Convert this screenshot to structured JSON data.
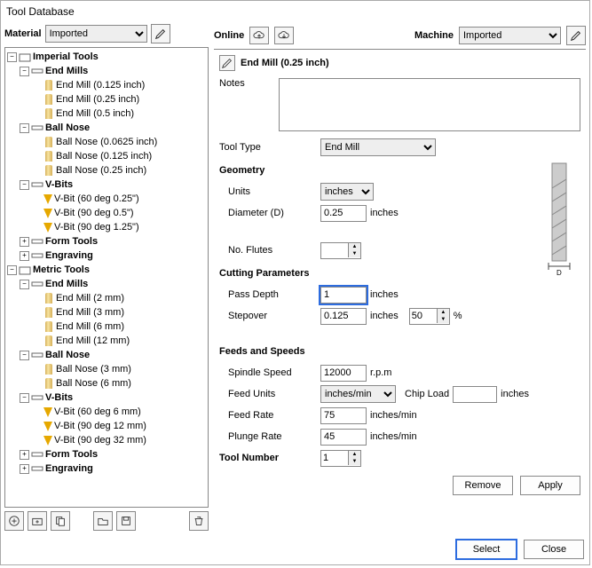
{
  "window": {
    "title": "Tool Database"
  },
  "topbar": {
    "material_label": "Material",
    "material_value": "Imported",
    "online_label": "Online",
    "machine_label": "Machine",
    "machine_value": "Imported"
  },
  "tree": {
    "root1": "Imperial Tools",
    "em_group": "End Mills",
    "em": [
      "End Mill (0.125 inch)",
      "End Mill (0.25 inch)",
      "End Mill (0.5 inch)"
    ],
    "bn_group": "Ball Nose",
    "bn": [
      "Ball Nose (0.0625 inch)",
      "Ball Nose (0.125 inch)",
      "Ball Nose (0.25 inch)"
    ],
    "vb_group": "V-Bits",
    "vb": [
      "V-Bit (60 deg 0.25\")",
      "V-Bit (90 deg 0.5\")",
      "V-Bit (90 deg 1.25\")"
    ],
    "ft_group": "Form Tools",
    "eng_group": "Engraving",
    "root2": "Metric Tools",
    "em2": [
      "End Mill (2 mm)",
      "End Mill (3 mm)",
      "End Mill (6 mm)",
      "End Mill (12 mm)"
    ],
    "bn2_group": "Ball Nose",
    "bn2": [
      "Ball Nose (3 mm)",
      "Ball Nose (6 mm)"
    ],
    "vb2_group": "V-Bits",
    "vb2": [
      "V-Bit (60 deg 6 mm)",
      "V-Bit (90 deg 12 mm)",
      "V-Bit (90 deg 32 mm)"
    ]
  },
  "tool": {
    "name": "End Mill (0.25 inch)",
    "notes_label": "Notes",
    "notes": "",
    "type_label": "Tool Type",
    "type_value": "End Mill",
    "geometry_label": "Geometry",
    "units_label": "Units",
    "units_value": "inches",
    "diameter_label": "Diameter (D)",
    "diameter_value": "0.25",
    "diameter_unit": "inches",
    "flutes_label": "No. Flutes",
    "flutes_value": "",
    "cutting_label": "Cutting Parameters",
    "passdepth_label": "Pass Depth",
    "passdepth_value": "1",
    "passdepth_unit": "inches",
    "stepover_label": "Stepover",
    "stepover_value": "0.125",
    "stepover_unit": "inches",
    "stepover_pct": "50",
    "pct_sym": "%",
    "feeds_label": "Feeds and Speeds",
    "spindle_label": "Spindle Speed",
    "spindle_value": "12000",
    "spindle_unit": "r.p.m",
    "feedunits_label": "Feed Units",
    "feedunits_value": "inches/min",
    "chipload_label": "Chip Load",
    "chipload_value": "",
    "chipload_unit": "inches",
    "feedrate_label": "Feed Rate",
    "feedrate_value": "75",
    "feedrate_unit": "inches/min",
    "plunge_label": "Plunge Rate",
    "plunge_value": "45",
    "plunge_unit": "inches/min",
    "toolnum_label": "Tool Number",
    "toolnum_value": "1",
    "d_label": "D"
  },
  "buttons": {
    "remove": "Remove",
    "apply": "Apply",
    "select": "Select",
    "close": "Close"
  }
}
